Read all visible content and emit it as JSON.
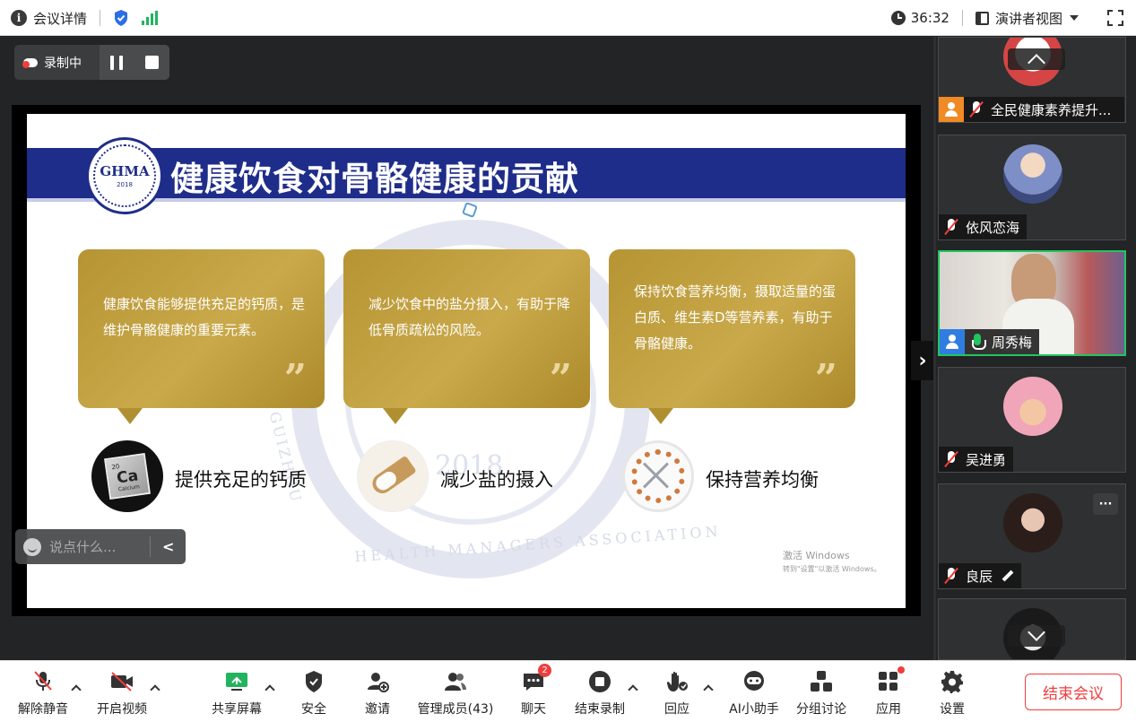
{
  "topbar": {
    "meeting_details_label": "会议详情",
    "timer": "36:32",
    "view_mode_label": "演讲者视图"
  },
  "recording": {
    "status_label": "录制中"
  },
  "slide": {
    "logo_text": "GHMA",
    "logo_year": "2018",
    "title": "健康饮食对骨骼健康的贡献",
    "watermark_year": "2018",
    "watermark_bottom": "HEALTH MANAGERS ASSOCIATION",
    "watermark_side": "GUIZHOU",
    "cards": [
      {
        "text": "健康饮食能够提供充足的钙质，是维护骨骼健康的重要元素。",
        "quote": "”"
      },
      {
        "text": "减少饮食中的盐分摄入，有助于降低骨质疏松的风险。",
        "quote": "”"
      },
      {
        "text": "保持饮食营养均衡，摄取适量的蛋白质、维生素D等营养素，有助于骨骼健康。",
        "quote": "”"
      }
    ],
    "ca_tile": {
      "number": "20",
      "symbol": "Ca",
      "name": "Calcium"
    },
    "labels": [
      "提供充足的钙质",
      "减少盐的摄入",
      "保持营养均衡"
    ],
    "activate_windows_line1": "激活 Windows",
    "activate_windows_line2": "转到\"设置\"以激活 Windows。"
  },
  "chat": {
    "placeholder": "说点什么..."
  },
  "participants": [
    {
      "name": "全民健康素养提升...",
      "mic": "muted",
      "host": true
    },
    {
      "name": "依风恋海",
      "mic": "muted",
      "host": false
    },
    {
      "name": "周秀梅",
      "mic": "on",
      "host": true,
      "video": true
    },
    {
      "name": "吴进勇",
      "mic": "muted",
      "host": false
    },
    {
      "name": "良辰",
      "mic": "muted",
      "host": false
    },
    {
      "name": "",
      "mic": "muted",
      "host": false
    }
  ],
  "toolbar": {
    "unmute": "解除静音",
    "start_video": "开启视频",
    "share_screen": "共享屏幕",
    "security": "安全",
    "invite": "邀请",
    "manage_members": "管理成员(43)",
    "chat": "聊天",
    "chat_badge": "2",
    "end_recording": "结束录制",
    "reactions": "回应",
    "ai_assistant": "AI小助手",
    "breakout": "分组讨论",
    "apps": "应用",
    "settings": "设置",
    "end_meeting": "结束会议"
  },
  "colors": {
    "banner_blue": "#1f2d8a",
    "card_gold": "#c9a94a",
    "active_speaker": "#22c55e",
    "danger_red": "#f03d3d"
  }
}
